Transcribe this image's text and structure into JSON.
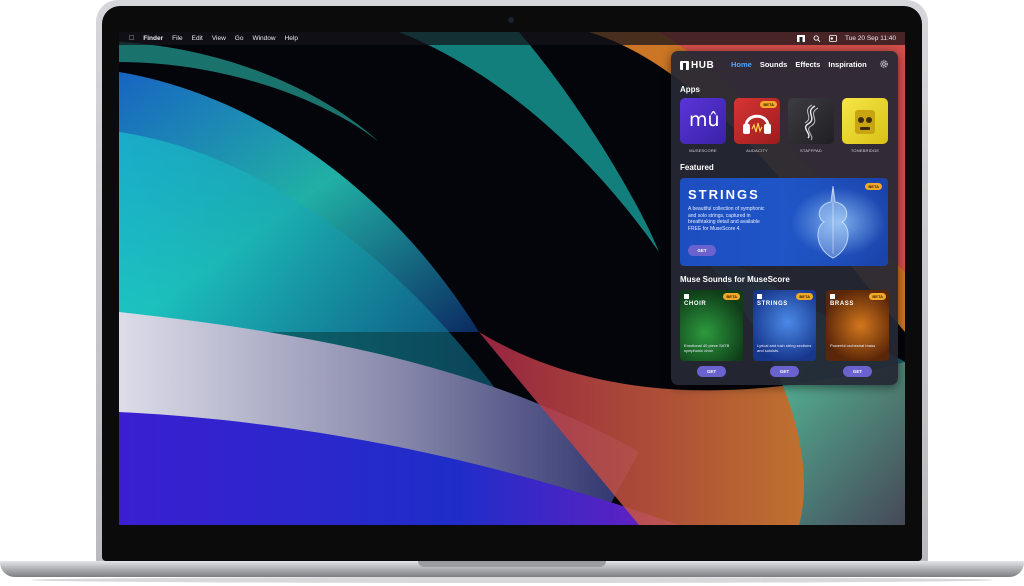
{
  "menubar": {
    "app": "Finder",
    "items": [
      "File",
      "Edit",
      "View",
      "Go",
      "Window",
      "Help"
    ],
    "clock": "Tue 20 Sep  11:40"
  },
  "hub": {
    "logo_text": "HUB",
    "tabs": [
      {
        "label": "Home",
        "active": true
      },
      {
        "label": "Sounds",
        "active": false
      },
      {
        "label": "Effects",
        "active": false
      },
      {
        "label": "Inspiration",
        "active": false
      }
    ],
    "apps_title": "Apps",
    "apps": [
      {
        "name": "MUSESCORE",
        "glyph": "mû",
        "color": "#4b2ec6",
        "beta": false
      },
      {
        "name": "AUDACITY",
        "glyph": "headphones-icon",
        "color": "#c62a2a",
        "beta": true,
        "badge": "BETA"
      },
      {
        "name": "STAFFPAD",
        "glyph": "staffpad-icon",
        "color": "#2e2e33",
        "beta": false
      },
      {
        "name": "TONEBRIDGE",
        "glyph": "tonebridge-icon",
        "color": "#f2dc24",
        "beta": false
      }
    ],
    "featured_title": "Featured",
    "featured": {
      "title": "STRINGS",
      "badge": "BETA",
      "description": "A beautiful collection of symphonic and solo strings, captured in breathtaking detail and available FREE for MuseScore 4.",
      "button": "GET"
    },
    "sounds_title": "Muse Sounds for MuseScore",
    "sounds": [
      {
        "name": "CHOIR",
        "badge": "BETA",
        "description": "Emotional 40 piece SATB symphonic choir",
        "button": "GET",
        "color": "#1d6b2c"
      },
      {
        "name": "STRINGS",
        "badge": "BETA",
        "description": "Lyrical and lush string sections and soloists.",
        "button": "GET",
        "color": "#1f4fb8"
      },
      {
        "name": "BRASS",
        "badge": "BETA",
        "description": "Powerful orchestral brass",
        "button": "GET",
        "color": "#9b4d12"
      }
    ]
  },
  "colors": {
    "accent": "#4ea6ff",
    "button": "#6a63cf",
    "beta_badge": "#f3a928"
  }
}
